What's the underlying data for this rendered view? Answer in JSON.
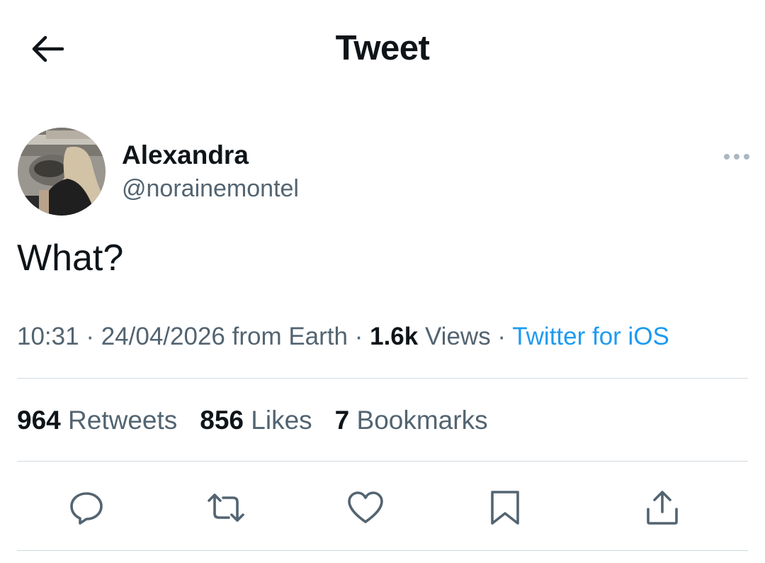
{
  "header": {
    "title": "Tweet"
  },
  "author": {
    "display_name": "Alexandra",
    "handle": "@norainemontel"
  },
  "tweet": {
    "text": "What?"
  },
  "meta": {
    "time": "10:31",
    "date": "24/04/2026",
    "location": "from Earth",
    "views_count": "1.6k",
    "views_label": "Views",
    "source": "Twitter for iOS",
    "separator": " · "
  },
  "stats": {
    "retweets_count": "964",
    "retweets_label": "Retweets",
    "likes_count": "856",
    "likes_label": "Likes",
    "bookmarks_count": "7",
    "bookmarks_label": "Bookmarks"
  },
  "colors": {
    "text": "#0f1419",
    "secondary": "#536471",
    "link": "#1d9bf0",
    "divider": "#cfd9de"
  },
  "icons": {
    "back": "arrow-left-icon",
    "more": "more-horizontal-icon",
    "reply": "reply-icon",
    "retweet": "retweet-icon",
    "like": "heart-icon",
    "bookmark": "bookmark-icon",
    "share": "share-icon"
  }
}
